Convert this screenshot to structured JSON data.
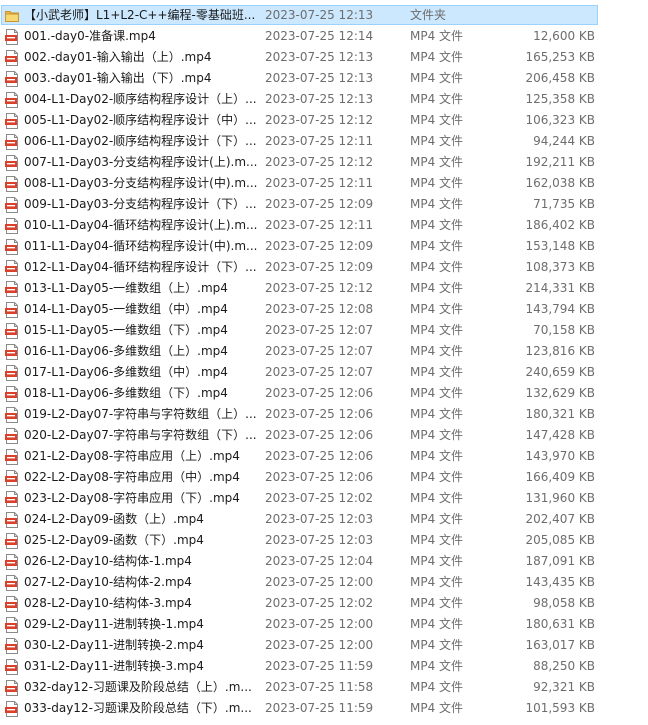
{
  "files": [
    {
      "name": "【小武老师】L1+L2-C++编程-零基础班...",
      "date": "2023-07-25 12:13",
      "type": "文件夹",
      "size": "",
      "icon": "folder-icon",
      "selected": true
    },
    {
      "name": "001.-day0-准备课.mp4",
      "date": "2023-07-25 12:14",
      "type": "MP4 文件",
      "size": "12,600 KB",
      "icon": "mp4-file-icon"
    },
    {
      "name": "002.-day01-输入输出（上）.mp4",
      "date": "2023-07-25 12:13",
      "type": "MP4 文件",
      "size": "165,253 KB",
      "icon": "mp4-file-icon"
    },
    {
      "name": "003.-day01-输入输出（下）.mp4",
      "date": "2023-07-25 12:13",
      "type": "MP4 文件",
      "size": "206,458 KB",
      "icon": "mp4-file-icon"
    },
    {
      "name": "004-L1-Day02-顺序结构程序设计（上）...",
      "date": "2023-07-25 12:13",
      "type": "MP4 文件",
      "size": "125,358 KB",
      "icon": "mp4-file-icon"
    },
    {
      "name": "005-L1-Day02-顺序结构程序设计（中）...",
      "date": "2023-07-25 12:12",
      "type": "MP4 文件",
      "size": "106,323 KB",
      "icon": "mp4-file-icon"
    },
    {
      "name": "006-L1-Day02-顺序结构程序设计（下）...",
      "date": "2023-07-25 12:11",
      "type": "MP4 文件",
      "size": "94,244 KB",
      "icon": "mp4-file-icon"
    },
    {
      "name": "007-L1-Day03-分支结构程序设计(上).m...",
      "date": "2023-07-25 12:12",
      "type": "MP4 文件",
      "size": "192,211 KB",
      "icon": "mp4-file-icon"
    },
    {
      "name": "008-L1-Day03-分支结构程序设计(中).m...",
      "date": "2023-07-25 12:11",
      "type": "MP4 文件",
      "size": "162,038 KB",
      "icon": "mp4-file-icon"
    },
    {
      "name": "009-L1-Day03-分支结构程序设计（下）...",
      "date": "2023-07-25 12:09",
      "type": "MP4 文件",
      "size": "71,735 KB",
      "icon": "mp4-file-icon"
    },
    {
      "name": "010-L1-Day04-循环结构程序设计(上).m...",
      "date": "2023-07-25 12:11",
      "type": "MP4 文件",
      "size": "186,402 KB",
      "icon": "mp4-file-icon"
    },
    {
      "name": "011-L1-Day04-循环结构程序设计(中).m...",
      "date": "2023-07-25 12:09",
      "type": "MP4 文件",
      "size": "153,148 KB",
      "icon": "mp4-file-icon"
    },
    {
      "name": "012-L1-Day04-循环结构程序设计（下）...",
      "date": "2023-07-25 12:09",
      "type": "MP4 文件",
      "size": "108,373 KB",
      "icon": "mp4-file-icon"
    },
    {
      "name": "013-L1-Day05-一维数组（上）.mp4",
      "date": "2023-07-25 12:12",
      "type": "MP4 文件",
      "size": "214,331 KB",
      "icon": "mp4-file-icon"
    },
    {
      "name": "014-L1-Day05-一维数组（中）.mp4",
      "date": "2023-07-25 12:08",
      "type": "MP4 文件",
      "size": "143,794 KB",
      "icon": "mp4-file-icon"
    },
    {
      "name": "015-L1-Day05-一维数组（下）.mp4",
      "date": "2023-07-25 12:07",
      "type": "MP4 文件",
      "size": "70,158 KB",
      "icon": "mp4-file-icon"
    },
    {
      "name": "016-L1-Day06-多维数组（上）.mp4",
      "date": "2023-07-25 12:07",
      "type": "MP4 文件",
      "size": "123,816 KB",
      "icon": "mp4-file-icon"
    },
    {
      "name": "017-L1-Day06-多维数组（中）.mp4",
      "date": "2023-07-25 12:07",
      "type": "MP4 文件",
      "size": "240,659 KB",
      "icon": "mp4-file-icon"
    },
    {
      "name": "018-L1-Day06-多维数组（下）.mp4",
      "date": "2023-07-25 12:06",
      "type": "MP4 文件",
      "size": "132,629 KB",
      "icon": "mp4-file-icon"
    },
    {
      "name": "019-L2-Day07-字符串与字符数组（上）...",
      "date": "2023-07-25 12:06",
      "type": "MP4 文件",
      "size": "180,321 KB",
      "icon": "mp4-file-icon"
    },
    {
      "name": "020-L2-Day07-字符串与字符数组（下）...",
      "date": "2023-07-25 12:06",
      "type": "MP4 文件",
      "size": "147,428 KB",
      "icon": "mp4-file-icon"
    },
    {
      "name": "021-L2-Day08-字符串应用（上）.mp4",
      "date": "2023-07-25 12:06",
      "type": "MP4 文件",
      "size": "143,970 KB",
      "icon": "mp4-file-icon"
    },
    {
      "name": "022-L2-Day08-字符串应用（中）.mp4",
      "date": "2023-07-25 12:06",
      "type": "MP4 文件",
      "size": "166,409 KB",
      "icon": "mp4-file-icon"
    },
    {
      "name": "023-L2-Day08-字符串应用（下）.mp4",
      "date": "2023-07-25 12:02",
      "type": "MP4 文件",
      "size": "131,960 KB",
      "icon": "mp4-file-icon"
    },
    {
      "name": "024-L2-Day09-函数（上）.mp4",
      "date": "2023-07-25 12:03",
      "type": "MP4 文件",
      "size": "202,407 KB",
      "icon": "mp4-file-icon"
    },
    {
      "name": "025-L2-Day09-函数（下）.mp4",
      "date": "2023-07-25 12:03",
      "type": "MP4 文件",
      "size": "205,085 KB",
      "icon": "mp4-file-icon"
    },
    {
      "name": "026-L2-Day10-结构体-1.mp4",
      "date": "2023-07-25 12:04",
      "type": "MP4 文件",
      "size": "187,091 KB",
      "icon": "mp4-file-icon"
    },
    {
      "name": "027-L2-Day10-结构体-2.mp4",
      "date": "2023-07-25 12:00",
      "type": "MP4 文件",
      "size": "143,435 KB",
      "icon": "mp4-file-icon"
    },
    {
      "name": "028-L2-Day10-结构体-3.mp4",
      "date": "2023-07-25 12:02",
      "type": "MP4 文件",
      "size": "98,058 KB",
      "icon": "mp4-file-icon"
    },
    {
      "name": "029-L2-Day11-进制转换-1.mp4",
      "date": "2023-07-25 12:00",
      "type": "MP4 文件",
      "size": "180,631 KB",
      "icon": "mp4-file-icon"
    },
    {
      "name": "030-L2-Day11-进制转换-2.mp4",
      "date": "2023-07-25 12:00",
      "type": "MP4 文件",
      "size": "163,017 KB",
      "icon": "mp4-file-icon"
    },
    {
      "name": "031-L2-Day11-进制转换-3.mp4",
      "date": "2023-07-25 11:59",
      "type": "MP4 文件",
      "size": "88,250 KB",
      "icon": "mp4-file-icon"
    },
    {
      "name": "032-day12-习题课及阶段总结（上）.m...",
      "date": "2023-07-25 11:58",
      "type": "MP4 文件",
      "size": "92,321 KB",
      "icon": "mp4-file-icon"
    },
    {
      "name": "033-day12-习题课及阶段总结（下）.m...",
      "date": "2023-07-25 11:59",
      "type": "MP4 文件",
      "size": "101,593 KB",
      "icon": "mp4-file-icon"
    }
  ],
  "colors": {
    "selection_bg": "#cce8ff",
    "selection_border": "#99d1ff",
    "folder_yellow": "#f8d775",
    "mp4_red": "#d9412b",
    "meta_text": "#6d6d6d"
  }
}
